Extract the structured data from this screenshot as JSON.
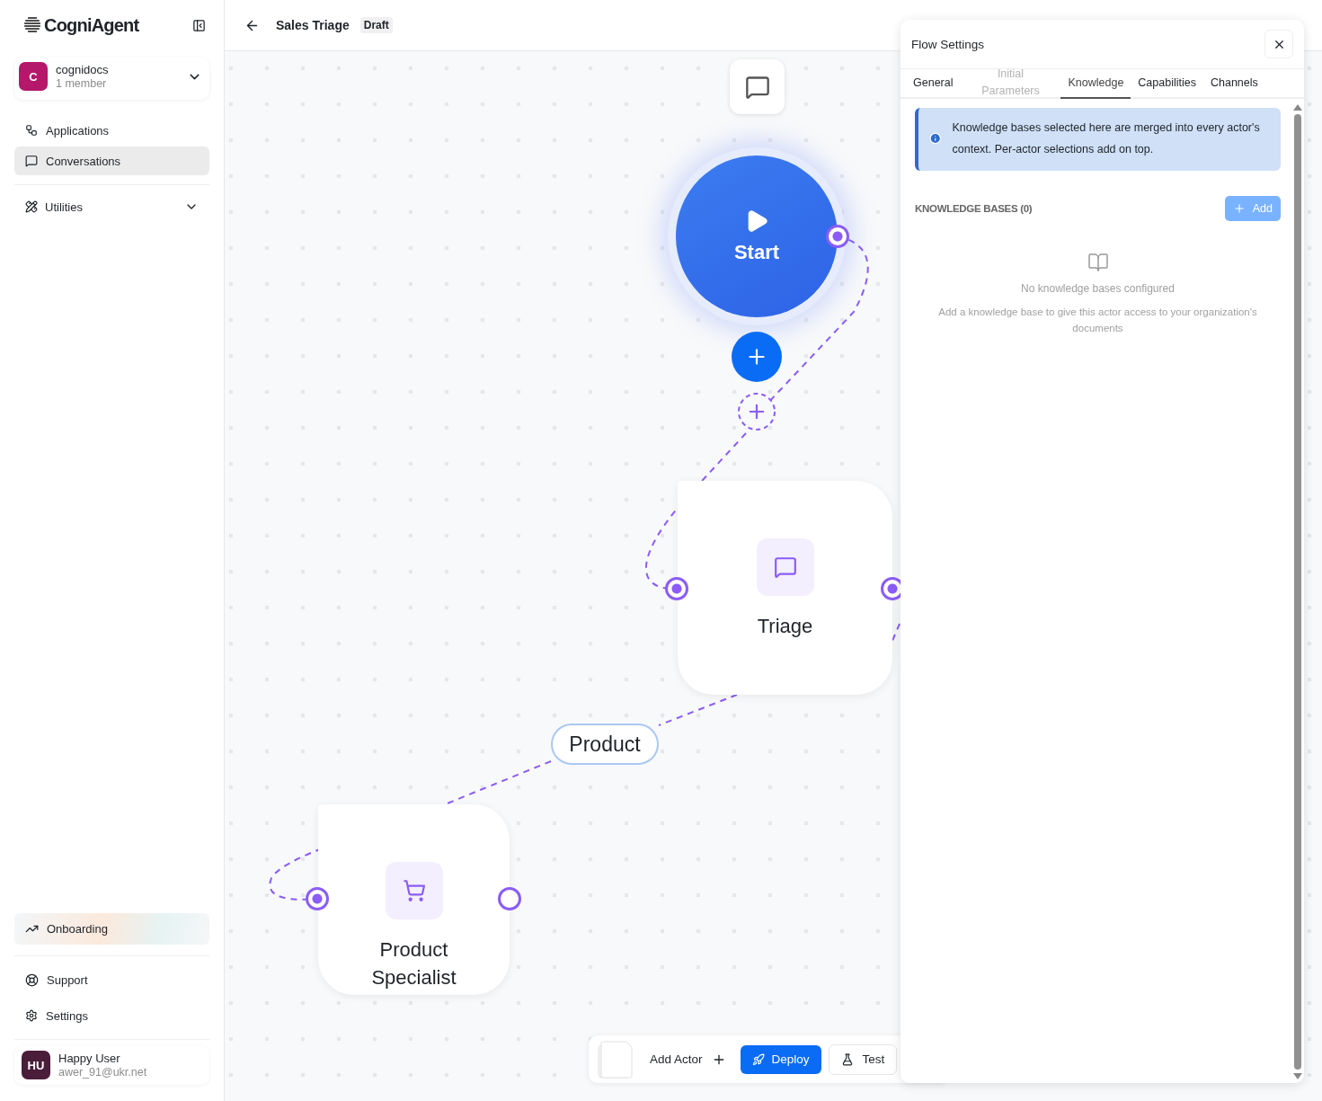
{
  "sidebar": {
    "logo": "CogniAgent",
    "workspace": {
      "initial": "C",
      "name": "cognidocs",
      "members": "1 member"
    },
    "nav": [
      {
        "label": "Applications",
        "kind": "apps",
        "selected": false
      },
      {
        "label": "Conversations",
        "kind": "chat",
        "selected": true
      }
    ],
    "utilities": {
      "label": "Utilities",
      "expanded": false
    },
    "onboarding": "Onboarding",
    "bottom": [
      {
        "label": "Support",
        "kind": "support"
      },
      {
        "label": "Settings",
        "kind": "settings"
      }
    ],
    "user": {
      "initials": "HU",
      "name": "Happy User",
      "email": "awer_91@ukr.net"
    }
  },
  "header": {
    "title": "Sales Triage",
    "status": "Draft"
  },
  "canvas": {
    "start": {
      "label": "Start",
      "connected": true
    },
    "nodes": [
      {
        "label": "Triage",
        "kind": "chat",
        "in_connected": true,
        "out_connected": true
      },
      {
        "label": "Product Specialist",
        "kind": "cart",
        "in_connected": true,
        "out_connected": false
      }
    ],
    "edge_label": "Product"
  },
  "toolbar": {
    "add": "Add Actor",
    "deploy": "Deploy",
    "test": "Test"
  },
  "panel": {
    "title": "Flow Settings",
    "tabs": [
      {
        "label": "General",
        "selected": false,
        "disabled": false
      },
      {
        "label": "Initial Parameters",
        "selected": false,
        "disabled": true
      },
      {
        "label": "Knowledge",
        "selected": true,
        "disabled": false
      },
      {
        "label": "Capabilities",
        "selected": false,
        "disabled": false
      },
      {
        "label": "Channels",
        "selected": false,
        "disabled": false
      }
    ],
    "info": "Knowledge bases selected here are merged into every actor's context. Per-actor selections add on top.",
    "section": "KNOWLEDGE BASES (0)",
    "add": "Add",
    "empty_title": "No knowledge bases configured",
    "empty_text": "Add a knowledge base to give this actor access to your organization's documents"
  }
}
